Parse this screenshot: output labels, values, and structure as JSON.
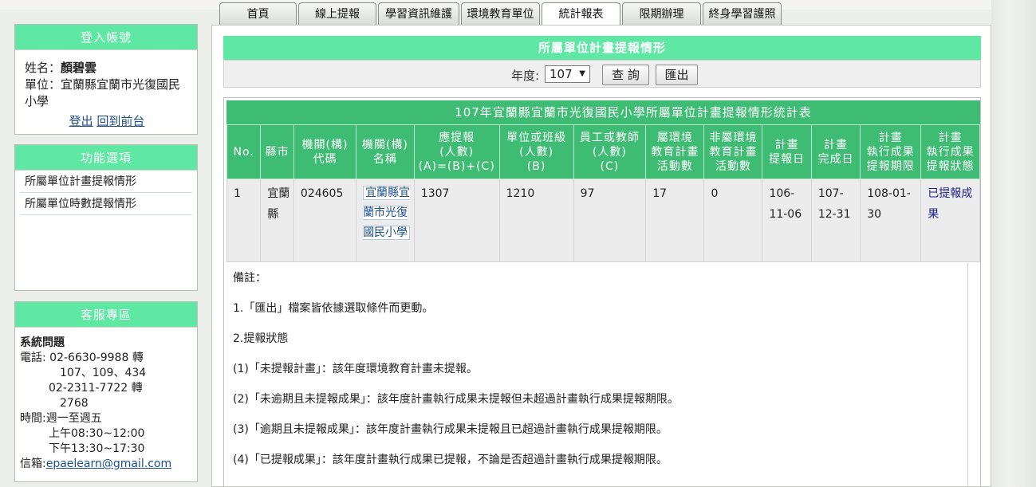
{
  "tabs": [
    "首頁",
    "線上提報",
    "學習資訊維護",
    "環境教育單位",
    "統計報表",
    "限期辦理",
    "終身學習護照"
  ],
  "login": {
    "title": "登入帳號",
    "name_label": "姓名：",
    "name": "顏碧雲",
    "unit_label": "單位：",
    "unit": "宜蘭縣宜蘭市光復國民小學",
    "logout": "登出",
    "back": "回到前台"
  },
  "functions": {
    "title": "功能選項",
    "items": [
      "所屬單位計畫提報情形",
      "所屬單位時數提報情形"
    ]
  },
  "service": {
    "title": "客服專區",
    "heading": "系統問題",
    "phone_label": "電話:",
    "phone1": "02-6630-9988 轉",
    "ext1": "107、109、434",
    "phone2": "02-2311-7722 轉",
    "ext2": "2768",
    "time_label": "時間:",
    "days": "週一至週五",
    "am": "上午08:30~12:00",
    "pm": "下午13:30~17:30",
    "email_label": "信箱:",
    "email": "epaelearn@gmail.com"
  },
  "main": {
    "title": "所屬單位計畫提報情形",
    "year_label": "年度:",
    "year": "107",
    "query": "查 詢",
    "export": "匯出"
  },
  "table": {
    "caption": "107年宜蘭縣宜蘭市光復國民小學所屬單位計畫提報情形統計表",
    "headers": [
      "No.",
      "縣市",
      "機關(構)\n代碼",
      "機關(構)\n名稱",
      "應提報\n(人數)\n(A)=(B)+(C)",
      "單位或班級\n(人數)\n(B)",
      "員工或教師\n(人數)\n(C)",
      "屬環境\n教育計畫\n活動數",
      "非屬環境\n教育計畫\n活動數",
      "計畫\n提報日",
      "計畫\n完成日",
      "計畫\n執行成果\n提報期限",
      "計畫\n執行成果\n提報狀態"
    ],
    "row": {
      "no": "1",
      "city": "宜蘭縣",
      "code": "024605",
      "org": "宜蘭縣宜蘭市光復國民小學",
      "a": "1307",
      "b": "1210",
      "c": "97",
      "env": "17",
      "nonenv": "0",
      "submit": "106-11-06",
      "done": "107-12-31",
      "deadline": "108-01-30",
      "status": "已提報成果"
    }
  },
  "notes": {
    "title": "備註：",
    "n1": "1.「匯出」檔案皆依據選取條件而更動。",
    "n2": "2.提報狀態",
    "s1": "(1)「未提報計畫」：該年度環境教育計畫未提報。",
    "s2": "(2)「未逾期且未提報成果」：該年度計畫執行成果未提報但未超過計畫執行成果提報期限。",
    "s3": "(3)「逾期且未提報成果」：該年度計畫執行成果未提報且已超過計畫執行成果提報期限。",
    "s4": "(4)「已提報成果」：該年度計畫執行成果已提報，不論是否超過計畫執行成果提報期限。"
  }
}
